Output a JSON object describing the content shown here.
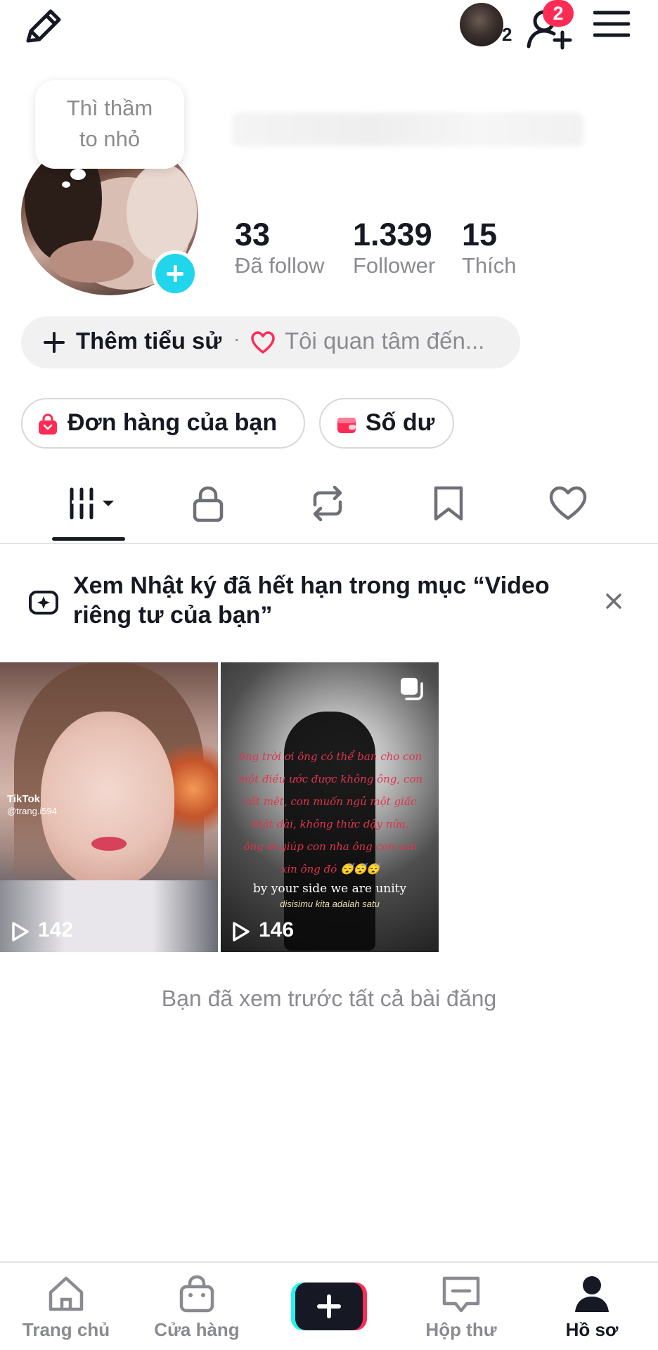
{
  "header": {
    "story_count": "2",
    "friend_badge": "2",
    "icons": [
      "pencil-icon",
      "add-friend-icon",
      "hamburger-menu-icon"
    ]
  },
  "profile": {
    "note": [
      "Thì thầm",
      "to nhỏ"
    ],
    "stats": [
      {
        "value": "33",
        "label": "Đã follow"
      },
      {
        "value": "1.339",
        "label": "Follower"
      },
      {
        "value": "15",
        "label": "Thích"
      }
    ],
    "bio": {
      "add_label": "Thêm tiểu sử",
      "separator": "·",
      "interest": "Tôi quan tâm đến..."
    },
    "shop": {
      "orders_label": "Đơn hàng của bạn",
      "balance_label": "Số dư"
    }
  },
  "tabs": [
    {
      "name": "videos",
      "icon": "grid-icon",
      "active": true
    },
    {
      "name": "private",
      "icon": "lock-icon"
    },
    {
      "name": "reposts",
      "icon": "repost-icon"
    },
    {
      "name": "saved",
      "icon": "bookmark-icon"
    },
    {
      "name": "liked",
      "icon": "heart-icon"
    }
  ],
  "notice": {
    "text": "Xem Nhật ký đã hết hạn trong mục “Video riêng tư của bạn”"
  },
  "videos": [
    {
      "views": "142",
      "watermark": [
        "TikTok",
        "@trang.i594"
      ]
    },
    {
      "views": "146",
      "poem": [
        "ông trời ơi ông có thể ban cho con",
        "một điều ước được không ông, con",
        "rất mệt, con muốn ngủ một giấc",
        "thật dài, không thức dậy nữa,",
        "ông ơi giúp con nha ông con van",
        "xin ông đó 😴😴😴"
      ],
      "caption": "by your side we are unity",
      "caption2": "disisimu kita adalah satu"
    }
  ],
  "end_text": "Bạn đã xem trước tất cả bài đăng",
  "nav": [
    {
      "label": "Trang chủ",
      "icon": "home-icon"
    },
    {
      "label": "Cửa hàng",
      "icon": "shop-bag-icon"
    },
    {
      "label": "",
      "icon": "create-plus-icon"
    },
    {
      "label": "Hộp thư",
      "icon": "inbox-icon"
    },
    {
      "label": "Hồ sơ",
      "icon": "profile-icon",
      "active": true
    }
  ],
  "colors": {
    "accent": "#fe2c55",
    "cyan": "#20d5ec",
    "text": "#161823",
    "muted": "#8a8b91"
  }
}
